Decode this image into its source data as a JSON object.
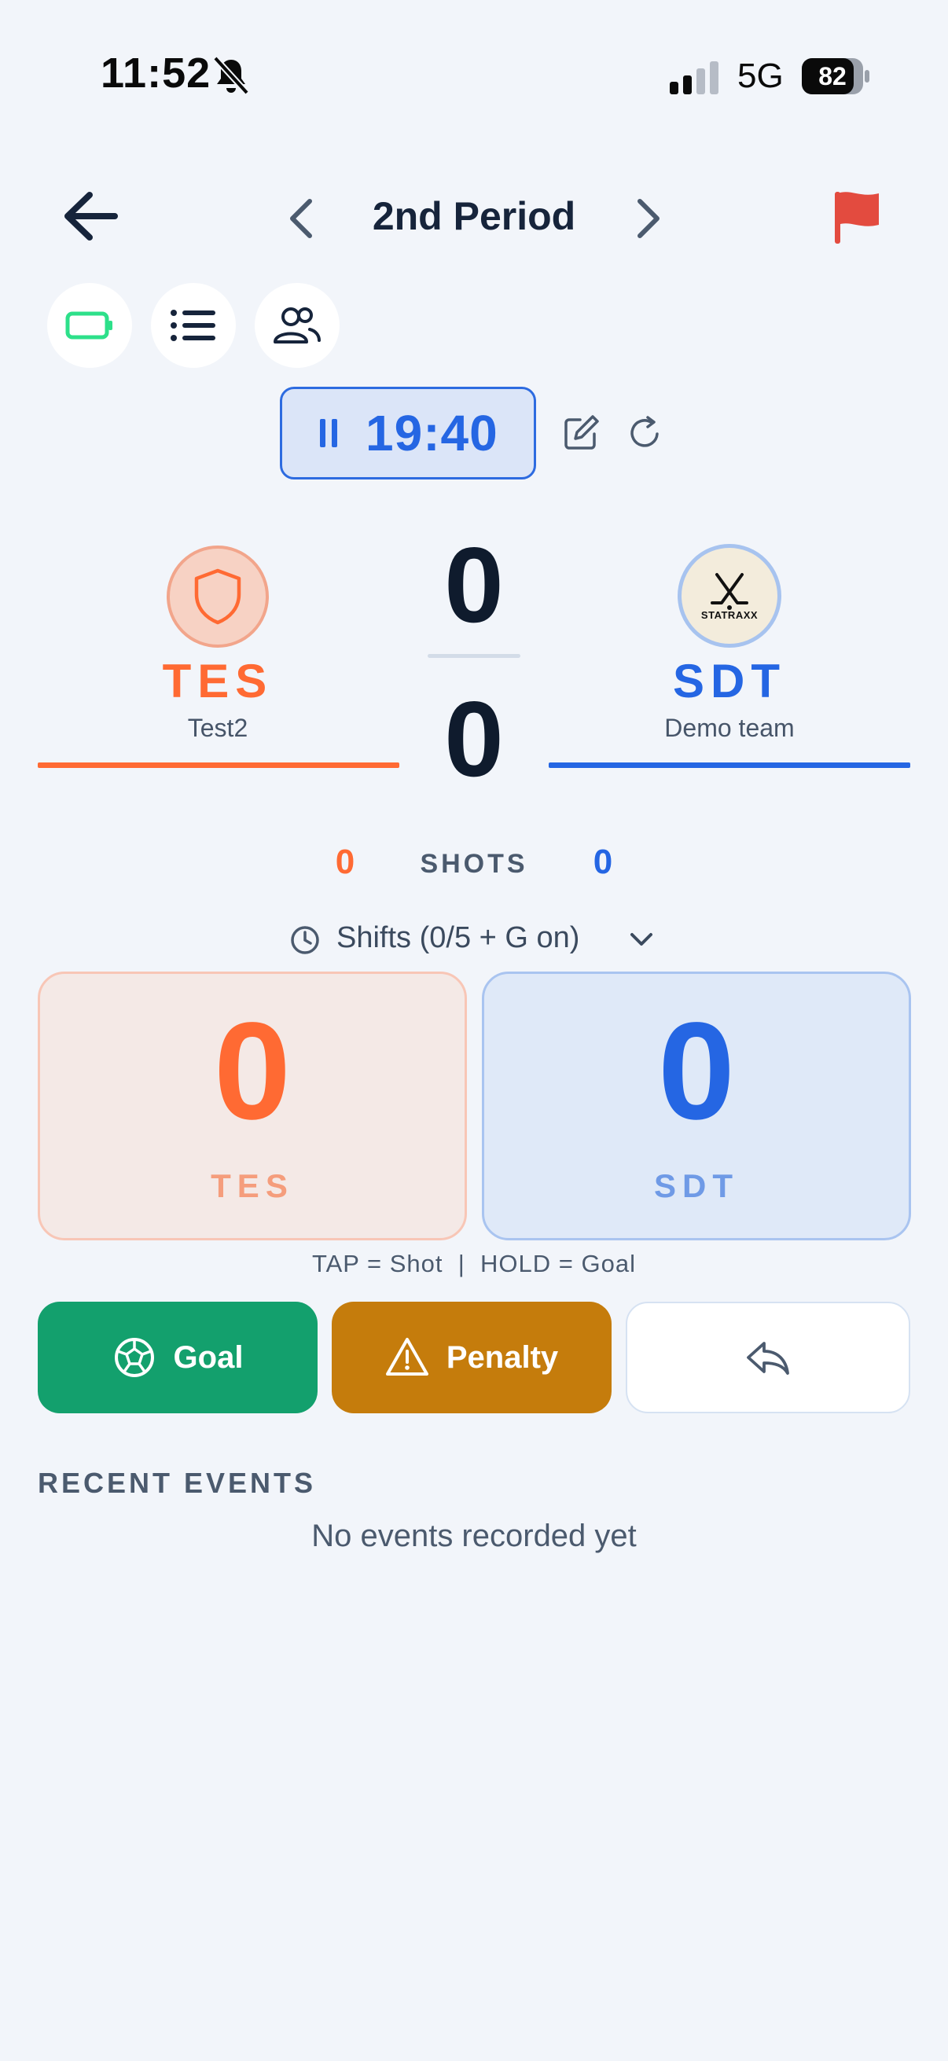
{
  "status_bar": {
    "time": "11:52",
    "network": "5G",
    "battery": "82"
  },
  "header": {
    "period_title": "2nd Period"
  },
  "timer": {
    "value": "19:40"
  },
  "home_team": {
    "abbr": "TES",
    "name": "Test2",
    "score": "0",
    "shots": "0",
    "color": "#ff6a33"
  },
  "away_team": {
    "abbr": "SDT",
    "name": "Demo team",
    "score": "0",
    "shots": "0",
    "logo_text": "STATRAXX",
    "color": "#2566e3"
  },
  "shots": {
    "label": "SHOTS"
  },
  "shifts": {
    "label": "Shifts (0/5 + G on)"
  },
  "panels": {
    "home_score": "0",
    "home_abbr": "TES",
    "away_score": "0",
    "away_abbr": "SDT",
    "hint": "TAP = Shot  |  HOLD = Goal"
  },
  "actions": {
    "goal_label": "Goal",
    "penalty_label": "Penalty"
  },
  "recent_events": {
    "title": "RECENT EVENTS",
    "empty_message": "No events recorded yet"
  },
  "icons": {
    "back": "arrow-left-icon",
    "prev": "chevron-left-icon",
    "next": "chevron-right-icon",
    "flag": "flag-icon",
    "battery_mode": "battery-icon",
    "list": "list-icon",
    "people": "people-icon",
    "edit": "edit-icon",
    "reset": "refresh-icon",
    "clock": "clock-icon",
    "goal": "soccer-ball-icon",
    "penalty": "warning-icon",
    "undo": "undo-icon"
  }
}
